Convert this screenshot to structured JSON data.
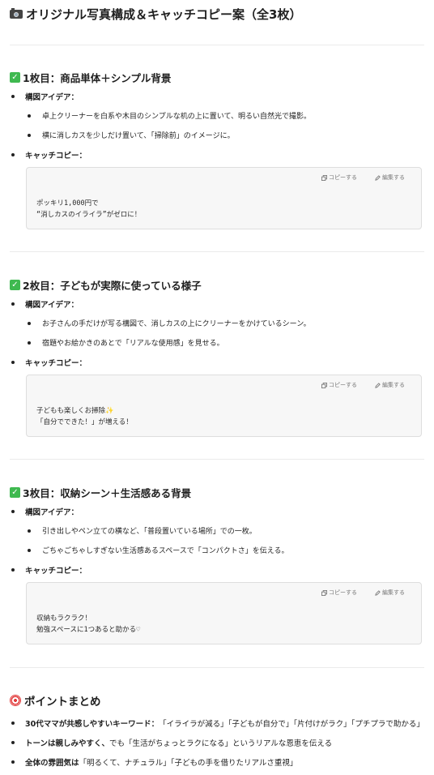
{
  "title": "オリジナル写真構成＆キャッチコピー案（全3枚）",
  "sections": [
    {
      "heading": "1枚目：商品単体＋シンプル背景",
      "idea_label": "構図アイデア：",
      "ideas": [
        "卓上クリーナーを白系や木目のシンプルな机の上に置いて、明るい自然光で撮影。",
        "横に消しカスを少しだけ置いて、「掃除前」のイメージに。"
      ],
      "copy_label": "キャッチコピー：",
      "copy_text": "ポッキリ1,000円で\n“消しカスのイライラ”がゼロに！"
    },
    {
      "heading": "2枚目：子どもが実際に使っている様子",
      "idea_label": "構図アイデア：",
      "ideas": [
        "お子さんの手だけが写る構図で、消しカスの上にクリーナーをかけているシーン。",
        "宿題やお絵かきのあとで「リアルな使用感」を見せる。"
      ],
      "copy_label": "キャッチコピー：",
      "copy_text": "子どもも楽しくお掃除✨\n「自分でできた！」が増える！"
    },
    {
      "heading": "3枚目：収納シーン＋生活感ある背景",
      "idea_label": "構図アイデア：",
      "ideas": [
        "引き出しやペン立ての横など、「普段置いている場所」での一枚。",
        "ごちゃごちゃしすぎない生活感あるスペースで「コンパクトさ」を伝える。"
      ],
      "copy_label": "キャッチコピー：",
      "copy_text": "収納もラクラク！\n勉強スペースに1つあると助かる♡"
    }
  ],
  "code_tools": {
    "copy": "コピーする",
    "edit": "編集する"
  },
  "summary": {
    "heading": "ポイントまとめ",
    "items": [
      {
        "bold": "30代ママが共感しやすいキーワード：",
        "text": "「イライラが減る」「子どもが自分で」「片付けがラク」「プチプラで助かる」"
      },
      {
        "bold": "トーンは親しみやすく、",
        "text": "でも「生活がちょっとラクになる」というリアルな恩恵を伝える"
      },
      {
        "bold": "全体の雰囲気は",
        "text": "「明るくて、ナチュラル」「子どもの手を借りたリアルさ重視」"
      }
    ]
  },
  "colors": {
    "check": "#3fb950",
    "target": "#e23b3b"
  },
  "icons": {
    "title": "camera-icon",
    "section": "check-mark-icon",
    "summary": "target-icon"
  }
}
